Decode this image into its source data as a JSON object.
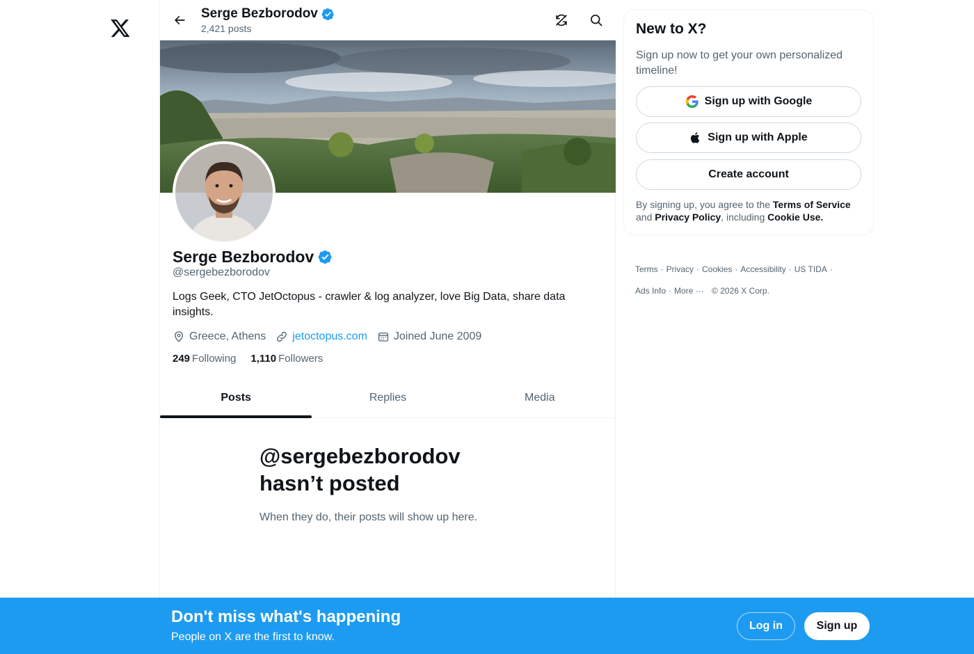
{
  "header": {
    "name": "Serge Bezborodov",
    "posts_count": "2,421 posts"
  },
  "profile": {
    "name": "Serge Bezborodov",
    "handle": "@sergebezborodov",
    "bio": "Logs Geek, CTO JetOctopus - crawler & log analyzer, love Big Data, share data insights.",
    "location": "Greece, Athens",
    "website": "jetoctopus.com",
    "joined": "Joined June 2009",
    "following_count": "249",
    "following_label": "Following",
    "followers_count": "1,110",
    "followers_label": "Followers",
    "verified_color": "#1d9bf0"
  },
  "tabs": [
    {
      "label": "Posts",
      "active": true
    },
    {
      "label": "Replies",
      "active": false
    },
    {
      "label": "Media",
      "active": false
    }
  ],
  "empty_state": {
    "title_line1": "@sergebezborodov",
    "title_line2": "hasn’t posted",
    "subtitle": "When they do, their posts will show up here."
  },
  "sidebar": {
    "title": "New to X?",
    "subtitle": "Sign up now to get your own personalized timeline!",
    "google_button": "Sign up with Google",
    "apple_button": "Sign up with Apple",
    "create_button": "Create account",
    "terms_prefix": "By signing up, you agree to the ",
    "terms_link": "Terms of Service",
    "terms_and": " and ",
    "privacy_link": "Privacy Policy",
    "terms_including": ", including ",
    "cookie_link": "Cookie Use."
  },
  "footer": {
    "links": [
      "Terms",
      "Privacy",
      "Cookies",
      "Accessibility",
      "US TIDA"
    ],
    "links2": [
      "Ads Info",
      "More ···"
    ],
    "copyright": "© 2026 X Corp."
  },
  "bottom_bar": {
    "title": "Don't miss what's happening",
    "subtitle": "People on X are the first to know.",
    "login": "Log in",
    "signup": "Sign up",
    "background": "#1d9bf0"
  },
  "icons": {
    "logo": "x-logo-icon",
    "back": "arrow-left-icon",
    "refresh": "refresh-icon",
    "search": "search-icon",
    "verified": "verified-badge-icon",
    "location": "location-pin-icon",
    "link": "link-icon",
    "calendar": "calendar-icon",
    "google": "google-icon",
    "apple": "apple-icon"
  }
}
